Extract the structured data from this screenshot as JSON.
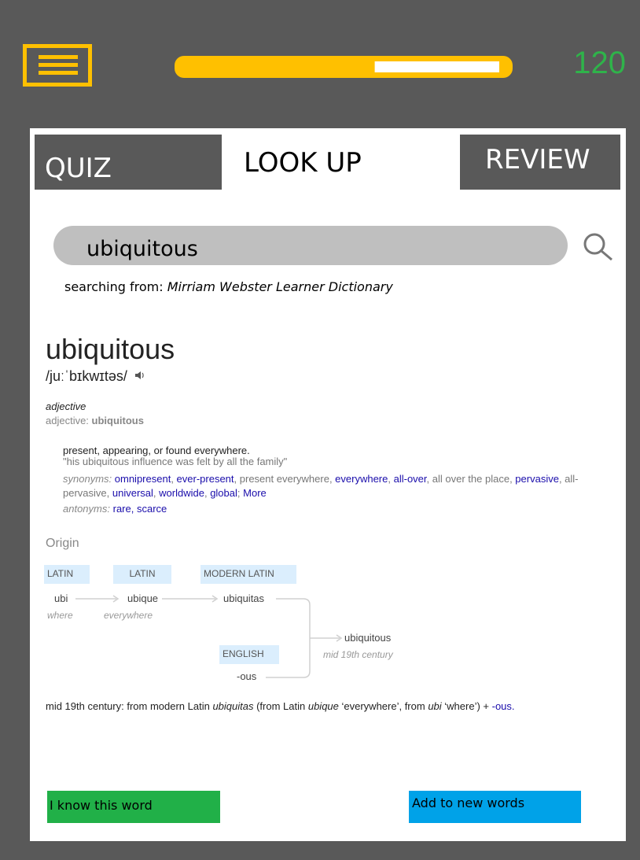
{
  "header": {
    "score": "120",
    "progress_fraction": 0.6,
    "colors": {
      "accent": "#ffc000",
      "score": "#2fb34a",
      "background": "#595959"
    }
  },
  "tabs": {
    "quiz": "QUIZ",
    "lookup": "LOOK UP",
    "review": "REVIEW"
  },
  "search": {
    "value": "ubiquitous",
    "source_prefix": "searching from:",
    "source_name": "Mirriam Webster Learner Dictionary"
  },
  "entry": {
    "word": "ubiquitous",
    "pronunciation": "/juːˈbɪkwɪtəs/",
    "pos": "adjective",
    "pos_form_label": "adjective:",
    "pos_form_word": "ubiquitous",
    "definition": "present, appearing, or found everywhere.",
    "example": "\"his ubiquitous influence was felt by all the family\"",
    "synonyms_label": "synonyms:",
    "synonyms": [
      {
        "text": "omnipresent",
        "link": true
      },
      {
        "text": "ever-present",
        "link": true
      },
      {
        "text": "present everywhere",
        "link": false
      },
      {
        "text": "everywhere",
        "link": true
      },
      {
        "text": "all-over",
        "link": true
      },
      {
        "text": "all over the place",
        "link": false
      },
      {
        "text": "pervasive",
        "link": true
      },
      {
        "text": "all-pervasive",
        "link": false
      },
      {
        "text": "universal",
        "link": true
      },
      {
        "text": "worldwide",
        "link": true
      },
      {
        "text": "global",
        "link": true
      }
    ],
    "more_label": "More",
    "antonyms_label": "antonyms:",
    "antonyms": [
      "rare",
      "scarce"
    ]
  },
  "origin": {
    "title": "Origin",
    "langs": {
      "latin1": "LATIN",
      "latin2": "LATIN",
      "modern_latin": "MODERN LATIN",
      "english": "ENGLISH"
    },
    "words": {
      "ubi": "ubi",
      "ubique": "ubique",
      "ubiquitas": "ubiquitas",
      "ubiquitous": "ubiquitous",
      "ous": "-ous"
    },
    "glosses": {
      "ubi": "where",
      "ubique": "everywhere",
      "ubiquitous": "mid 19th century"
    },
    "etymology": {
      "p1": "mid 19th century: from modern Latin ",
      "w1": "ubiquitas",
      "p2": " (from Latin ",
      "w2": "ubique",
      "p3": " ‘everywhere’, from ",
      "w3": "ubi",
      "p4": " ‘where’) + ",
      "link": "-ous."
    }
  },
  "actions": {
    "know": "I know this word",
    "add": "Add to new words"
  }
}
